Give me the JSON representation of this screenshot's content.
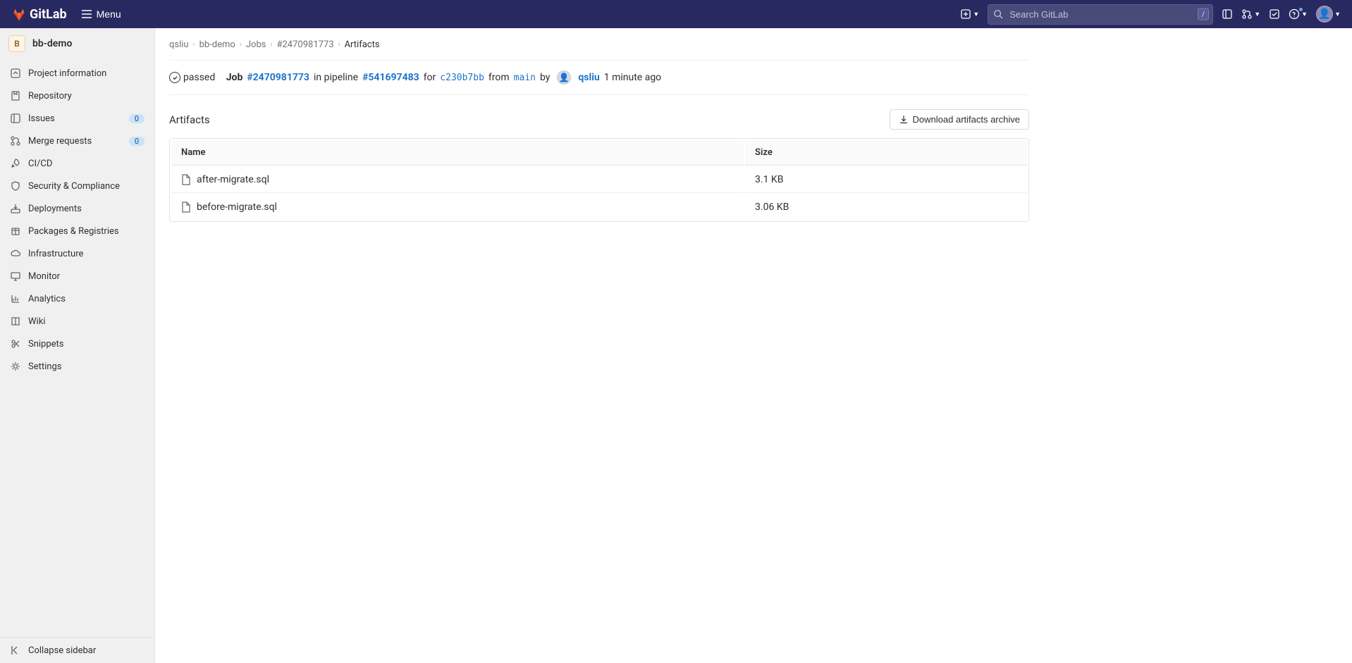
{
  "header": {
    "brand": "GitLab",
    "menu_label": "Menu",
    "search_placeholder": "Search GitLab",
    "search_shortcut": "/"
  },
  "project": {
    "initial": "B",
    "name": "bb-demo"
  },
  "sidebar": {
    "items": [
      {
        "label": "Project information",
        "icon": "info"
      },
      {
        "label": "Repository",
        "icon": "repo"
      },
      {
        "label": "Issues",
        "icon": "issues",
        "badge": "0"
      },
      {
        "label": "Merge requests",
        "icon": "merge",
        "badge": "0"
      },
      {
        "label": "CI/CD",
        "icon": "rocket"
      },
      {
        "label": "Security & Compliance",
        "icon": "shield"
      },
      {
        "label": "Deployments",
        "icon": "deploy"
      },
      {
        "label": "Packages & Registries",
        "icon": "package"
      },
      {
        "label": "Infrastructure",
        "icon": "cloud"
      },
      {
        "label": "Monitor",
        "icon": "monitor"
      },
      {
        "label": "Analytics",
        "icon": "chart"
      },
      {
        "label": "Wiki",
        "icon": "book"
      },
      {
        "label": "Snippets",
        "icon": "scissors"
      },
      {
        "label": "Settings",
        "icon": "gear"
      }
    ],
    "collapse_label": "Collapse sidebar"
  },
  "breadcrumb": {
    "items": [
      {
        "label": "qsliu"
      },
      {
        "label": "bb-demo"
      },
      {
        "label": "Jobs"
      },
      {
        "label": "#2470981773"
      }
    ],
    "current": "Artifacts"
  },
  "job": {
    "status_text": "passed",
    "job_label": "Job",
    "job_id": "#2470981773",
    "pipeline_text": "in pipeline",
    "pipeline_id": "#541697483",
    "for_text": "for",
    "commit_sha": "c230b7bb",
    "from_text": "from",
    "branch": "main",
    "by_text": "by",
    "user": "qsliu",
    "time": "1 minute ago"
  },
  "artifacts": {
    "title": "Artifacts",
    "download_label": "Download artifacts archive",
    "columns": {
      "name": "Name",
      "size": "Size"
    },
    "files": [
      {
        "name": "after-migrate.sql",
        "size": "3.1 KB"
      },
      {
        "name": "before-migrate.sql",
        "size": "3.06 KB"
      }
    ]
  }
}
